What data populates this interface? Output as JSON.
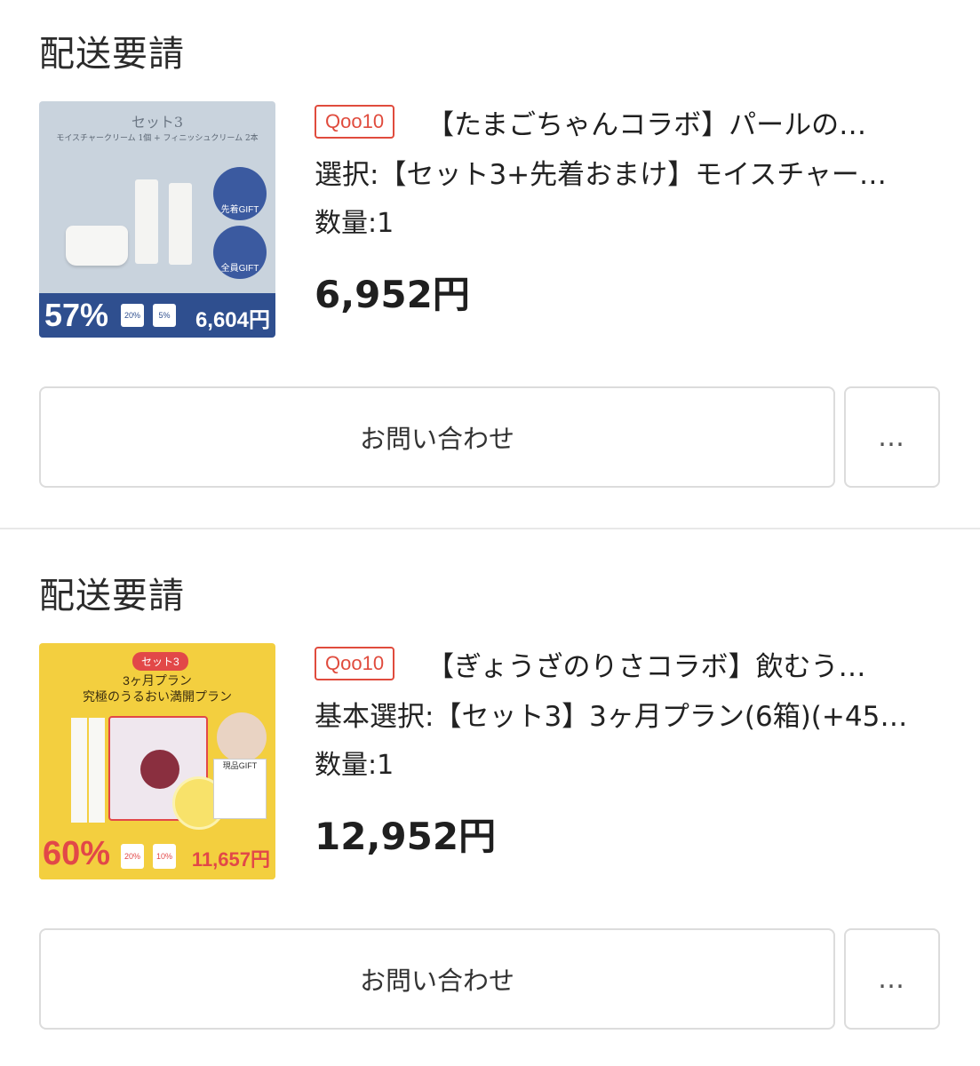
{
  "orders": [
    {
      "status": "配送要請",
      "badge": "Qoo10",
      "title": "【たまごちゃんコラボ】パールの…",
      "option": "選択:【セット3+先着おまけ】モイスチャー…",
      "quantity": "数量:1",
      "price": "6,952円",
      "inquiry_label": "お問い合わせ",
      "more_label": "…",
      "image": {
        "set_label": "セット3",
        "subtitle": "モイスチャークリーム 1個 + フィニッシュクリーム 2本",
        "gift1": "先着GIFT",
        "gift2": "全員GIFT",
        "discount": "57%",
        "coupon1": "20%",
        "coupon2": "5%",
        "mega_price": "6,604円"
      }
    },
    {
      "status": "配送要請",
      "badge": "Qoo10",
      "title": "【ぎょうざのりさコラボ】飲むう…",
      "option": "基本選択:【セット3】3ヶ月プラン(6箱)(+45…",
      "quantity": "数量:1",
      "price": "12,952円",
      "inquiry_label": "お問い合わせ",
      "more_label": "…",
      "image": {
        "set_label": "セット3",
        "line1": "3ヶ月プラン",
        "line2": "究極のうるおい満開プラン",
        "gift": "現品GIFT",
        "discount": "60%",
        "coupon1": "20%",
        "coupon2": "10%",
        "mega_price": "11,657円"
      }
    }
  ]
}
